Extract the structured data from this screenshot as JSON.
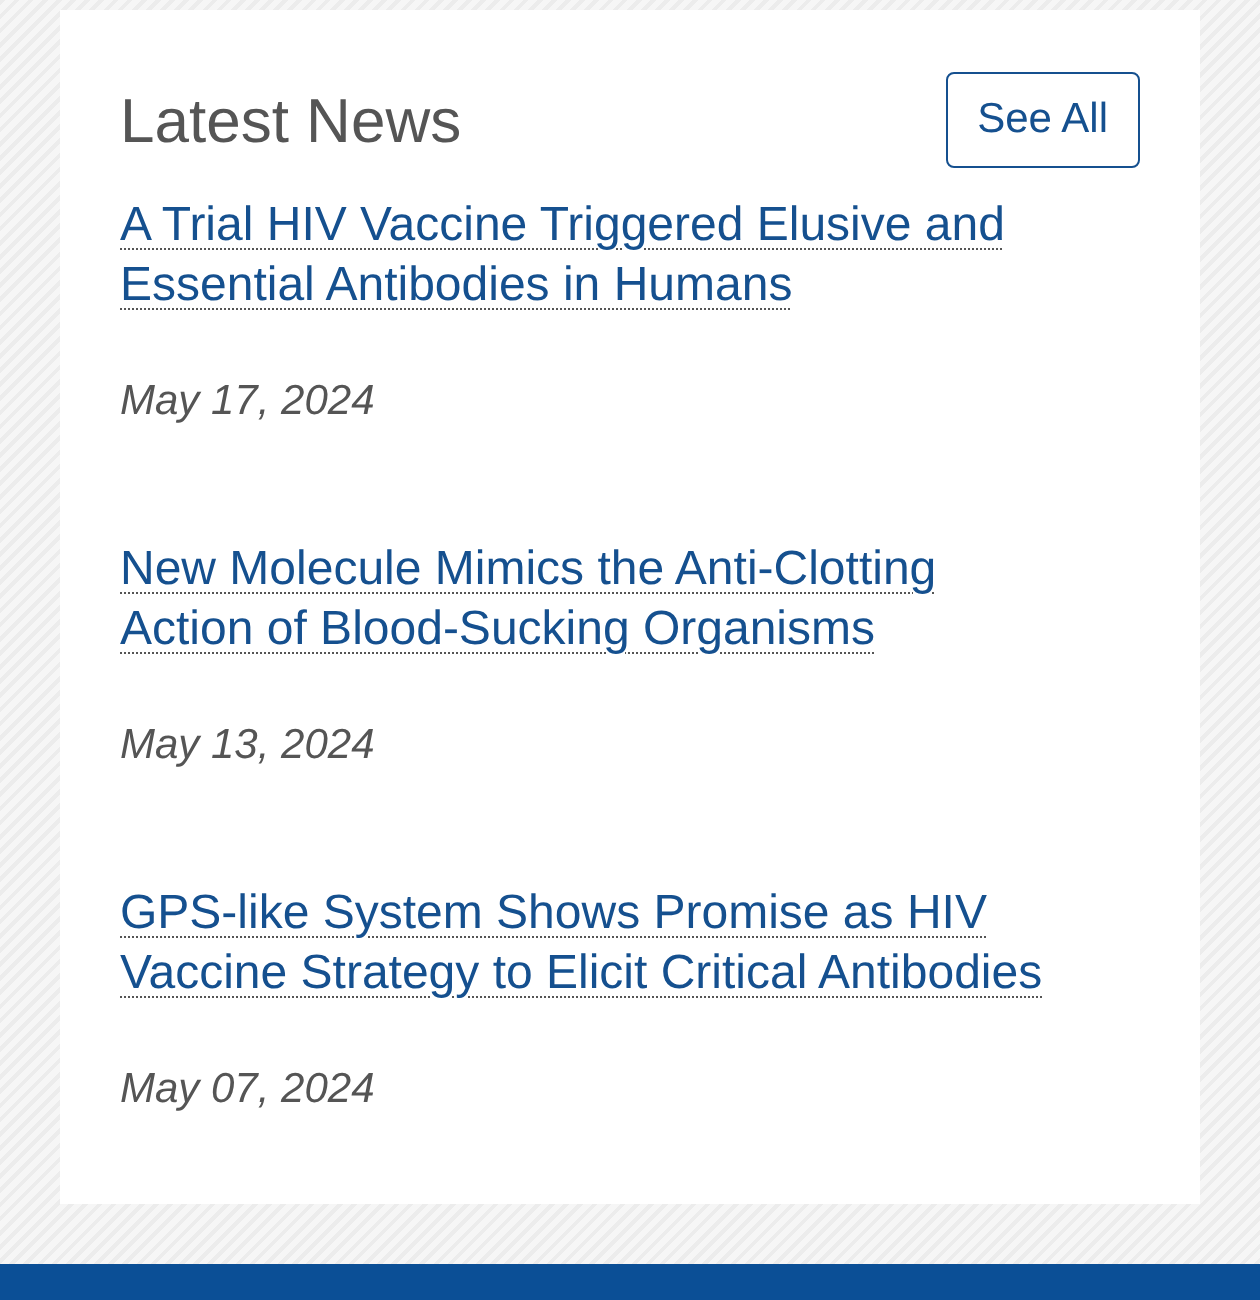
{
  "news_panel": {
    "title": "Latest News",
    "see_all_button": "See All",
    "items": [
      {
        "headline": "A Trial HIV Vaccine Triggered Elusive and Essential Antibodies in Humans",
        "date": "May 17, 2024"
      },
      {
        "headline": "New Molecule Mimics the Anti-Clotting Action of Blood-Sucking Organisms",
        "date": "May 13, 2024"
      },
      {
        "headline": "GPS-like System Shows Promise as HIV Vaccine Strategy to Elicit Critical Antibodies",
        "date": "May 07, 2024"
      }
    ]
  }
}
